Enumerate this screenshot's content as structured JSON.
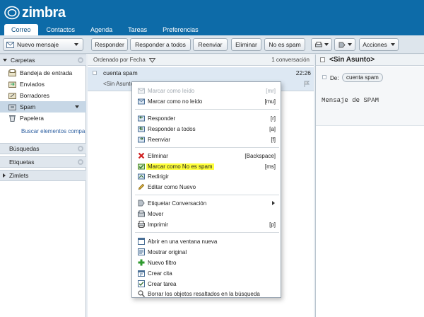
{
  "app": {
    "logo_text": "zimbra"
  },
  "tabs": [
    {
      "label": "Correo",
      "active": true
    },
    {
      "label": "Contactos"
    },
    {
      "label": "Agenda"
    },
    {
      "label": "Tareas"
    },
    {
      "label": "Preferencias"
    }
  ],
  "toolbar": {
    "new_message": "Nuevo mensaje",
    "reply": "Responder",
    "reply_all": "Responder a todos",
    "forward": "Reenviar",
    "delete": "Eliminar",
    "not_spam": "No es spam",
    "actions": "Acciones"
  },
  "sidebar": {
    "folders_title": "Carpetas",
    "folders": [
      {
        "label": "Bandeja de entrada",
        "icon": "inbox-icon"
      },
      {
        "label": "Enviados",
        "icon": "sent-icon"
      },
      {
        "label": "Borradores",
        "icon": "drafts-icon"
      },
      {
        "label": "Spam",
        "icon": "spam-icon",
        "selected": true
      },
      {
        "label": "Papelera",
        "icon": "trash-icon"
      }
    ],
    "search_link": "Buscar elementos compa",
    "searches": "Búsquedas",
    "tags": "Etiquetas",
    "zimlets": "Zimlets"
  },
  "list": {
    "sort_label": "Ordenado por Fecha",
    "count_label": "1 conversación",
    "message": {
      "subject": "cuenta spam",
      "time": "22:26",
      "preview": "<Sin Asunto>"
    }
  },
  "reading": {
    "subject": "<Sin Asunto>",
    "from_label": "De:",
    "from_value": "cuenta spam",
    "body": "Mensaje de SPAM"
  },
  "context_menu": {
    "groups": [
      [
        {
          "label": "Marcar como leído",
          "key": "[mr]",
          "icon": "mark-read-icon",
          "disabled": true
        },
        {
          "label": "Marcar como no leído",
          "key": "[mu]",
          "icon": "mark-unread-icon"
        }
      ],
      [
        {
          "label": "Responder",
          "key": "[r]",
          "icon": "reply-icon"
        },
        {
          "label": "Responder a todos",
          "key": "[a]",
          "icon": "reply-all-icon"
        },
        {
          "label": "Reenviar",
          "key": "[f]",
          "icon": "forward-icon"
        }
      ],
      [
        {
          "label": "Eliminar",
          "key": "[Backspace]",
          "icon": "delete-icon"
        },
        {
          "label": "Marcar como No es spam",
          "key": "[ms]",
          "icon": "not-spam-icon",
          "highlighted": true
        },
        {
          "label": "Redirigir",
          "key": "",
          "icon": "redirect-icon"
        },
        {
          "label": "Editar como Nuevo",
          "key": "",
          "icon": "edit-icon"
        }
      ],
      [
        {
          "label": "Etiquetar Conversación",
          "key": "",
          "icon": "tag-icon",
          "submenu": true
        },
        {
          "label": "Mover",
          "key": "",
          "icon": "move-icon"
        },
        {
          "label": "Imprimir",
          "key": "[p]",
          "icon": "print-icon"
        }
      ],
      [
        {
          "label": "Abrir en una ventana nueva",
          "key": "",
          "icon": "new-window-icon"
        },
        {
          "label": "Mostrar original",
          "key": "",
          "icon": "show-original-icon"
        },
        {
          "label": "Nuevo filtro",
          "key": "",
          "icon": "new-filter-icon"
        },
        {
          "label": "Crear cita",
          "key": "",
          "icon": "create-appointment-icon"
        },
        {
          "label": "Crear tarea",
          "key": "",
          "icon": "create-task-icon"
        },
        {
          "label": "Borrar los objetos resaltados en la búsqueda",
          "key": "",
          "icon": "clear-highlight-icon"
        }
      ]
    ]
  },
  "colors": {
    "header": "#0d6ba8",
    "selection": "#c7d7e6",
    "highlight": "#ffff3a"
  }
}
